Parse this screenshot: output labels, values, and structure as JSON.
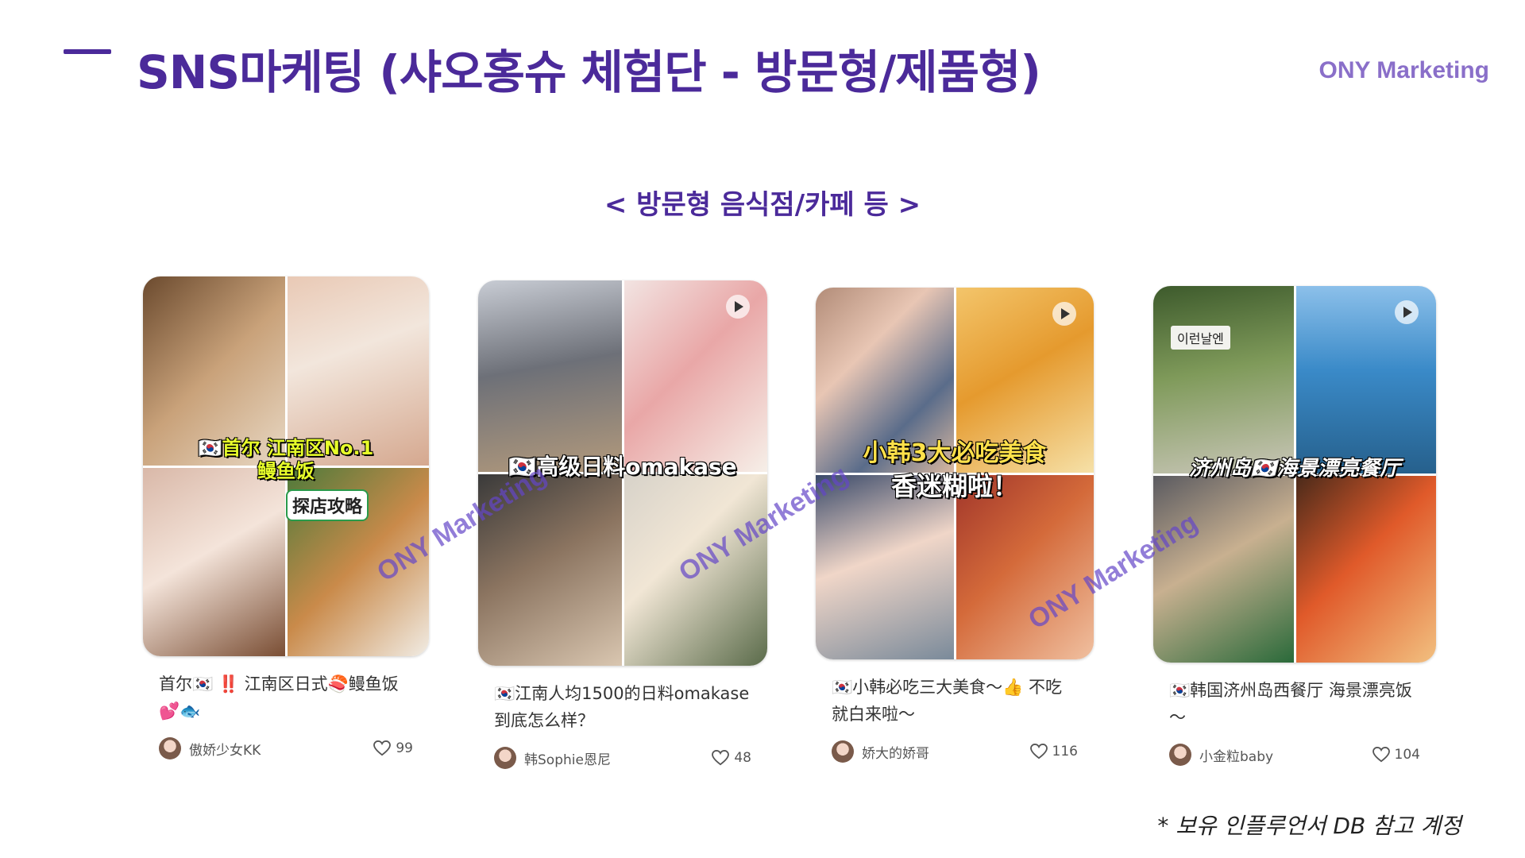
{
  "header": {
    "title": "SNS마케팅 (샤오홍슈 체험단 - 방문형/제품형)",
    "brand": "ONY Marketing"
  },
  "section": {
    "subtitle": "< 방문형 음식점/카페 등 >"
  },
  "cards": [
    {
      "overlay_line1": "🇰🇷首尔 江南区No.1",
      "overlay_line2": "鳗鱼饭",
      "overlay_line3": "探店攻略",
      "caption": "首尔🇰🇷 ‼️ 江南区日式🍣鳗鱼饭 💕🐟",
      "author": "傲娇少女KK",
      "likes": "99"
    },
    {
      "overlay_line1": "🇰🇷高级日料omakase",
      "caption": "🇰🇷江南人均1500的日料omakase到底怎么样？",
      "author": "韩Sophie恩尼",
      "likes": "48"
    },
    {
      "overlay_line1": "小韩3大必吃美食",
      "overlay_line2": "香迷糊啦！",
      "caption": "🇰🇷小韩必吃三大美食～👍 不吃就白来啦～",
      "author": "娇大的娇哥",
      "likes": "116"
    },
    {
      "overlay_line1": "济州岛🇰🇷海景漂亮餐厅",
      "sign_text": "이런날엔",
      "caption": "🇰🇷韩国济州岛西餐厅 海景漂亮饭～",
      "author": "小金粒baby",
      "likes": "104"
    }
  ],
  "watermark": "ONY Marketing",
  "footnote": "* 보유 인플루언서 DB 참고 계정",
  "colors": {
    "accent": "#4b2a9a",
    "brand": "#8a6fc9",
    "watermark": "#6446c8"
  }
}
